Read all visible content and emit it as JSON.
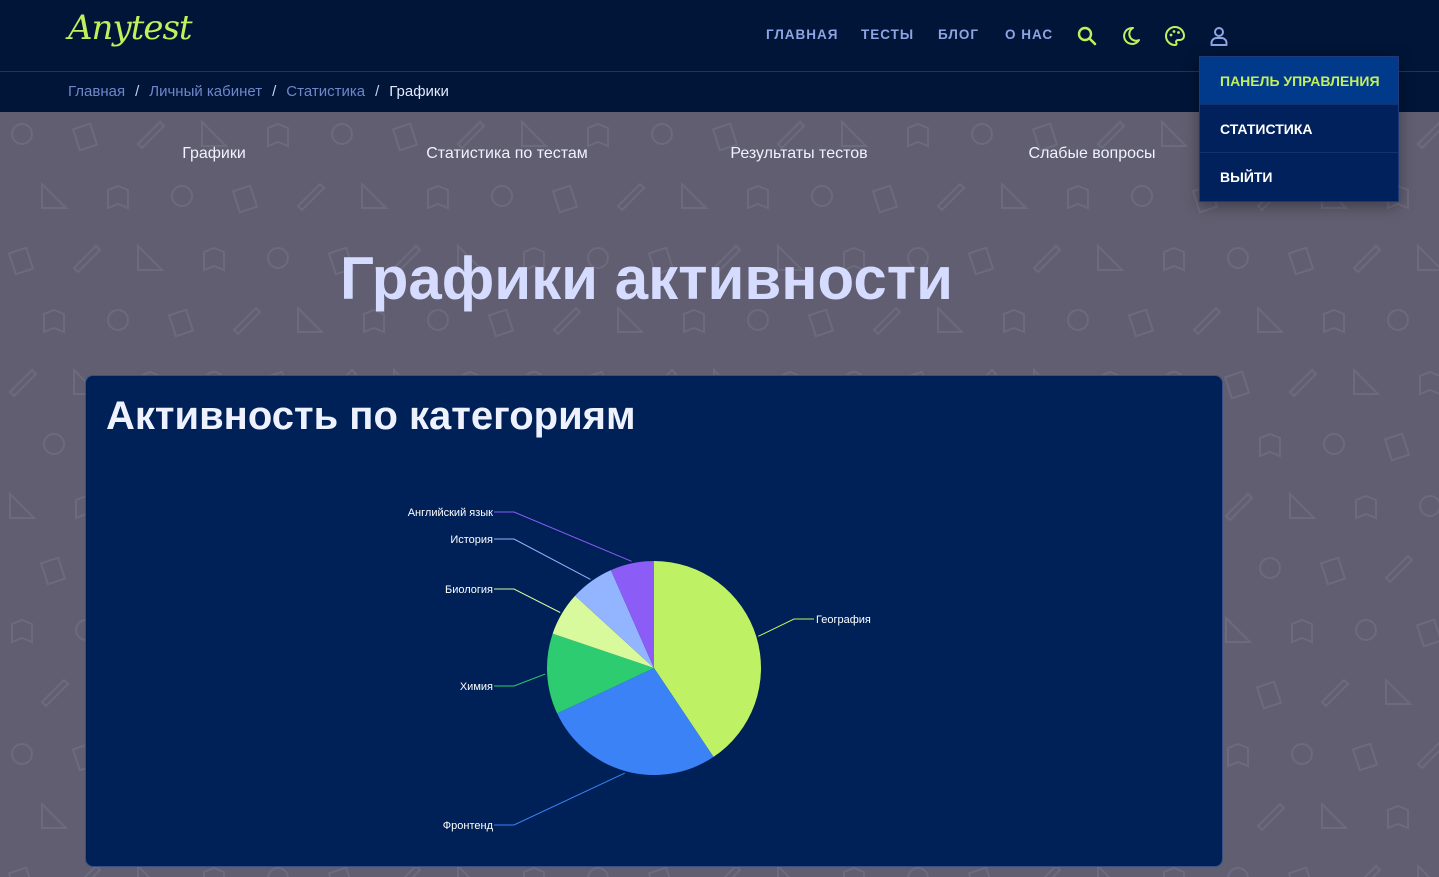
{
  "brand": {
    "logo_text": "Anytest"
  },
  "nav": {
    "links": [
      "ГЛАВНАЯ",
      "ТЕСТЫ",
      "БЛОГ",
      "О НАС"
    ],
    "icons": [
      "search-icon",
      "moon-icon",
      "palette-icon",
      "user-icon"
    ]
  },
  "breadcrumb": {
    "items": [
      "Главная",
      "Личный кабинет",
      "Статистика"
    ],
    "current": "Графики",
    "separator": "/"
  },
  "tabs": [
    "Графики",
    "Статистика по тестам",
    "Результаты тестов",
    "Слабые вопросы"
  ],
  "page_title": "Графики активности",
  "card": {
    "title": "Активность по категориям"
  },
  "user_menu": {
    "items": [
      "ПАНЕЛЬ УПРАВЛЕНИЯ",
      "СТАТИСТИКА",
      "ВЫЙТИ"
    ],
    "active_index": 0
  },
  "colors": {
    "accent": "#c2f05c",
    "header_bg": "#001538",
    "card_bg": "#002157"
  },
  "chart_data": {
    "type": "pie",
    "title": "",
    "start_angle_deg": 0,
    "slices": [
      {
        "label": "География",
        "value": 40,
        "color": "#bef264"
      },
      {
        "label": "Фронтенд",
        "value": 27,
        "color": "#3b82f6"
      },
      {
        "label": "Химия",
        "value": 12,
        "color": "#2ecc71"
      },
      {
        "label": "Биология",
        "value": 6.5,
        "color": "#d9f99d"
      },
      {
        "label": "История",
        "value": 6.5,
        "color": "#93b4ff"
      },
      {
        "label": "Английский язык",
        "value": 6.5,
        "color": "#8b5cf6"
      }
    ]
  }
}
